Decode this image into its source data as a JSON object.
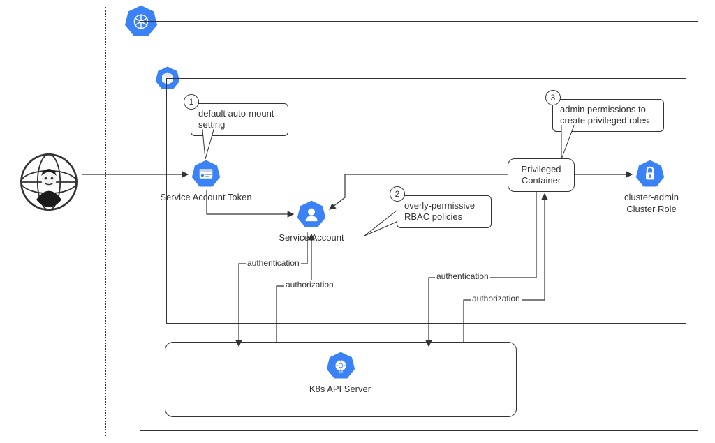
{
  "nodes": {
    "attacker": "Attacker",
    "kubernetes_cluster": "Kubernetes Cluster",
    "node": "Node",
    "service_account_token": "Service Account Token",
    "service_account": "Service Account",
    "privileged_container": "Privileged Container",
    "cluster_admin_role": "cluster-admin Cluster Role",
    "k8s_api_server": "K8s API Server"
  },
  "callouts": {
    "one": {
      "num": "1",
      "text": "default auto-mount setting"
    },
    "two": {
      "num": "2",
      "text": "overly-permissive RBAC policies"
    },
    "three": {
      "num": "3",
      "text": "admin permissions to create privileged roles"
    }
  },
  "edges": {
    "authn1": "authentication",
    "authz1": "authorization",
    "authn2": "authentication",
    "authz2": "authorization"
  },
  "colors": {
    "blue": "#3b82f6",
    "dark": "#1f2937"
  }
}
